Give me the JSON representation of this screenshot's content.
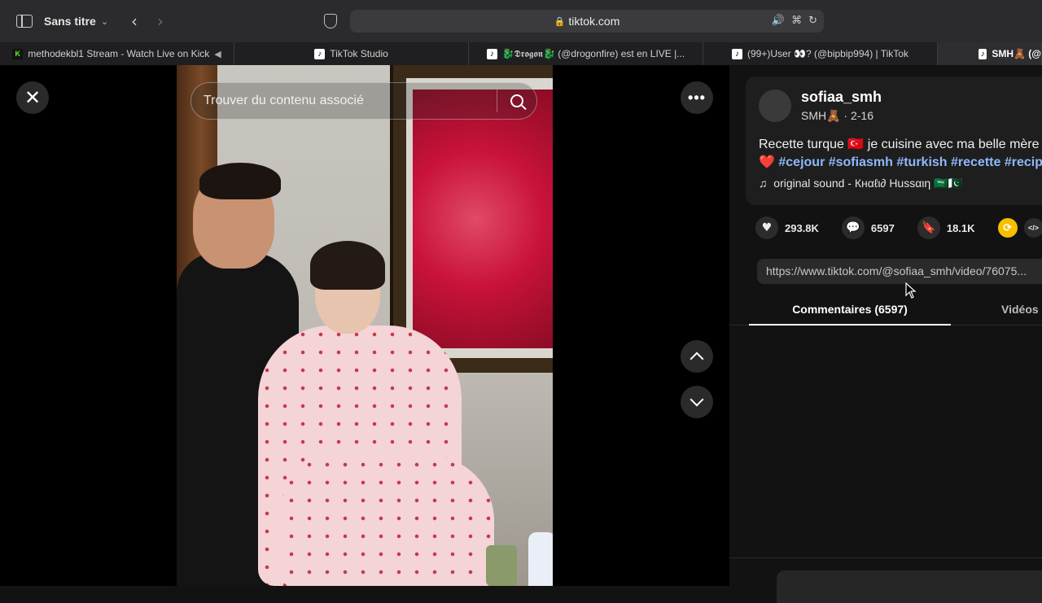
{
  "browser": {
    "group_name": "Sans titre",
    "address": "tiktok.com",
    "tabs": [
      {
        "label": "methodekbl1 Stream - Watch Live on Kick"
      },
      {
        "label": "TikTok Studio"
      },
      {
        "label": "🐉𝕯𝖗𝖔𝖌𝖔𝖓🐉 (@drogonfire) est en LIVE |..."
      },
      {
        "label": "(99+)User 👀? (@bipbip994) | TikTok"
      },
      {
        "label": "SMH🧸 (@"
      }
    ]
  },
  "video": {
    "search_placeholder": "Trouver du contenu associé"
  },
  "post": {
    "username": "sofiaa_smh",
    "subline": "SMH🧸 · 2-16",
    "description_text": "Recette turque 🇹🇷 je cuisine avec ma belle mère",
    "hashtags": "#cejour #sofiasmh #turkish #recette #recipe",
    "sound": "original sound - Кнαℓι∂ Hussαιη 🇸🇦🇵🇰",
    "likes": "293.8K",
    "comments": "6597",
    "saves": "18.1K",
    "link": "https://www.tiktok.com/@sofiaa_smh/video/76075...",
    "tab_comments": "Commentaires (6597)",
    "tab_videos": "Vidéos c"
  },
  "colors": {
    "background": "#121212",
    "hashtag": "#8fb8ff",
    "share_accent": "#f6c000",
    "kick_green": "#53fc18"
  }
}
